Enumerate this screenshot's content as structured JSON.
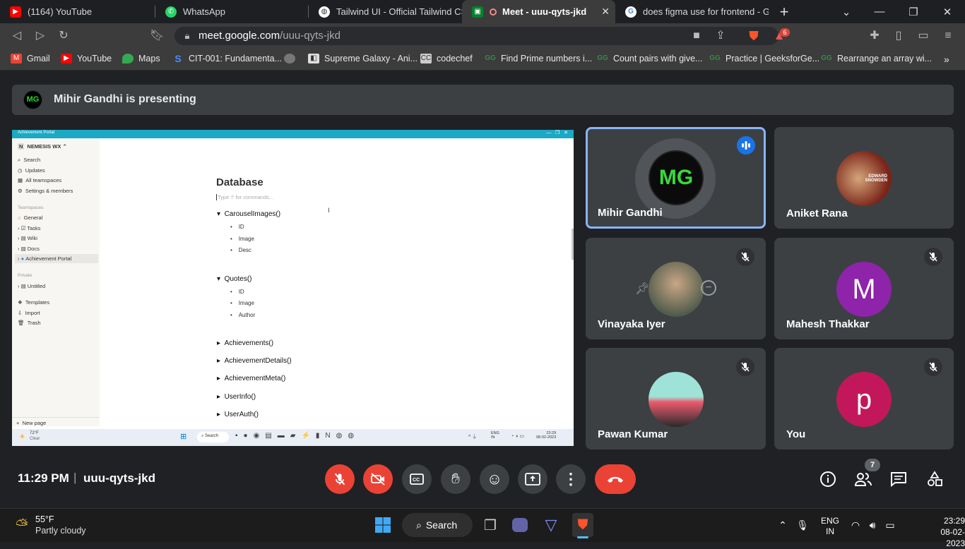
{
  "tabs": [
    {
      "title": "(1164) YouTube",
      "icon": "youtube-icon"
    },
    {
      "title": "WhatsApp",
      "icon": "whatsapp-icon"
    },
    {
      "title": "Tailwind UI - Official Tailwind CSS C",
      "icon": "globe-icon"
    },
    {
      "title": "Meet - uuu-qyts-jkd",
      "icon": "meet-icon"
    },
    {
      "title": "does figma use for frontend - Goo",
      "icon": "google-icon"
    }
  ],
  "address": {
    "host": "meet.google.com",
    "path": "/uuu-qyts-jkd",
    "brave_badge": "6"
  },
  "bookmarks": [
    "Gmail",
    "YouTube",
    "Maps",
    "CIT-001: Fundamenta...",
    "",
    "Supreme Galaxy - Ani...",
    "codechef",
    "Find Prime numbers i...",
    "Count pairs with give...",
    "Practice | GeeksforGe...",
    "Rearrange an array wi..."
  ],
  "presenting": {
    "initials": "MG",
    "text": "Mihir Gandhi is presenting"
  },
  "shared_screen": {
    "window_title": "Achievement Portal",
    "workspace": "NEMESIS WX",
    "side_top": [
      "Search",
      "Updates",
      "All teamspaces",
      "Settings & members"
    ],
    "teamspaces_label": "Teamspaces",
    "teamspaces": [
      "General",
      "Tasks",
      "Wiki",
      "Docs",
      "Achievement Portal"
    ],
    "private_label": "Private",
    "private": [
      "Untitled"
    ],
    "side_bottom": [
      "Templates",
      "Import",
      "Trash"
    ],
    "new_page": "New page",
    "page_title": "Database",
    "placeholder": "Type '/' for commands...",
    "blocks": [
      {
        "title": "CarouselImages()",
        "items": [
          "ID",
          "Image",
          "Desc"
        ]
      },
      {
        "title": "Quotes()",
        "items": [
          "ID",
          "Image",
          "Author"
        ]
      }
    ],
    "collapsed": [
      "Achievements()",
      "AchievementDetails()",
      "AchievementMeta()",
      "UserInfo()",
      "UserAuth()"
    ],
    "weather": {
      "temp": "72°F",
      "cond": "Clear"
    },
    "search": "Search",
    "lang": [
      "ENG",
      "IN"
    ],
    "clock": [
      "23:29",
      "08-02-2023"
    ]
  },
  "participants": [
    {
      "name": "Mihir Gandhi",
      "initials": "MG",
      "speaking": true
    },
    {
      "name": "Aniket Rana",
      "avatar_text": [
        "EDWARD",
        "SNOWDEN"
      ]
    },
    {
      "name": "Vinayaka Iyer",
      "muted": true
    },
    {
      "name": "Mahesh Thakkar",
      "initial": "M",
      "color": "#8e24aa",
      "muted": true
    },
    {
      "name": "Pawan Kumar",
      "muted": true
    },
    {
      "name": "You",
      "initial": "p",
      "color": "#c2185b",
      "muted": true
    }
  ],
  "controls": {
    "time": "11:29 PM",
    "divider": "|",
    "meeting_code": "uuu-qyts-jkd",
    "people_count": "7"
  },
  "taskbar": {
    "temp": "55°F",
    "weather": "Partly cloudy",
    "search": "Search",
    "lang": "ENG",
    "region": "IN",
    "time": "23:29",
    "date": "08-02-2023"
  },
  "colors": {
    "speaking": "#8ab4f8",
    "end_call": "#ea4335",
    "shared_title": "#1ba9c6"
  }
}
